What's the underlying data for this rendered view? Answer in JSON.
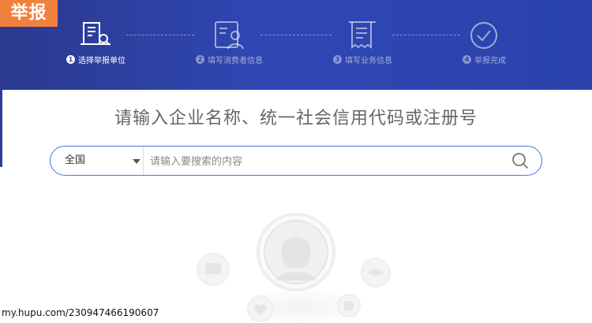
{
  "tag": {
    "label": "举报",
    "color": "#f0813d"
  },
  "steps": [
    {
      "num": "1",
      "label": "选择举报单位",
      "icon": "building-search-icon",
      "active": true
    },
    {
      "num": "2",
      "label": "填写消费者信息",
      "icon": "user-form-icon",
      "active": false
    },
    {
      "num": "3",
      "label": "填写业务信息",
      "icon": "receipt-icon",
      "active": false
    },
    {
      "num": "4",
      "label": "举报完成",
      "icon": "check-circle-icon",
      "active": false
    }
  ],
  "prompt": {
    "title": "请输入企业名称、统一社会信用代码或注册号"
  },
  "search": {
    "region": "全国",
    "placeholder": "请输入要搜索的内容",
    "icon": "search-icon",
    "border_color": "#4c73d8"
  },
  "header": {
    "background": "#2f47b3"
  },
  "watermark": {
    "text": "my.hupu.com/230947466190607"
  }
}
